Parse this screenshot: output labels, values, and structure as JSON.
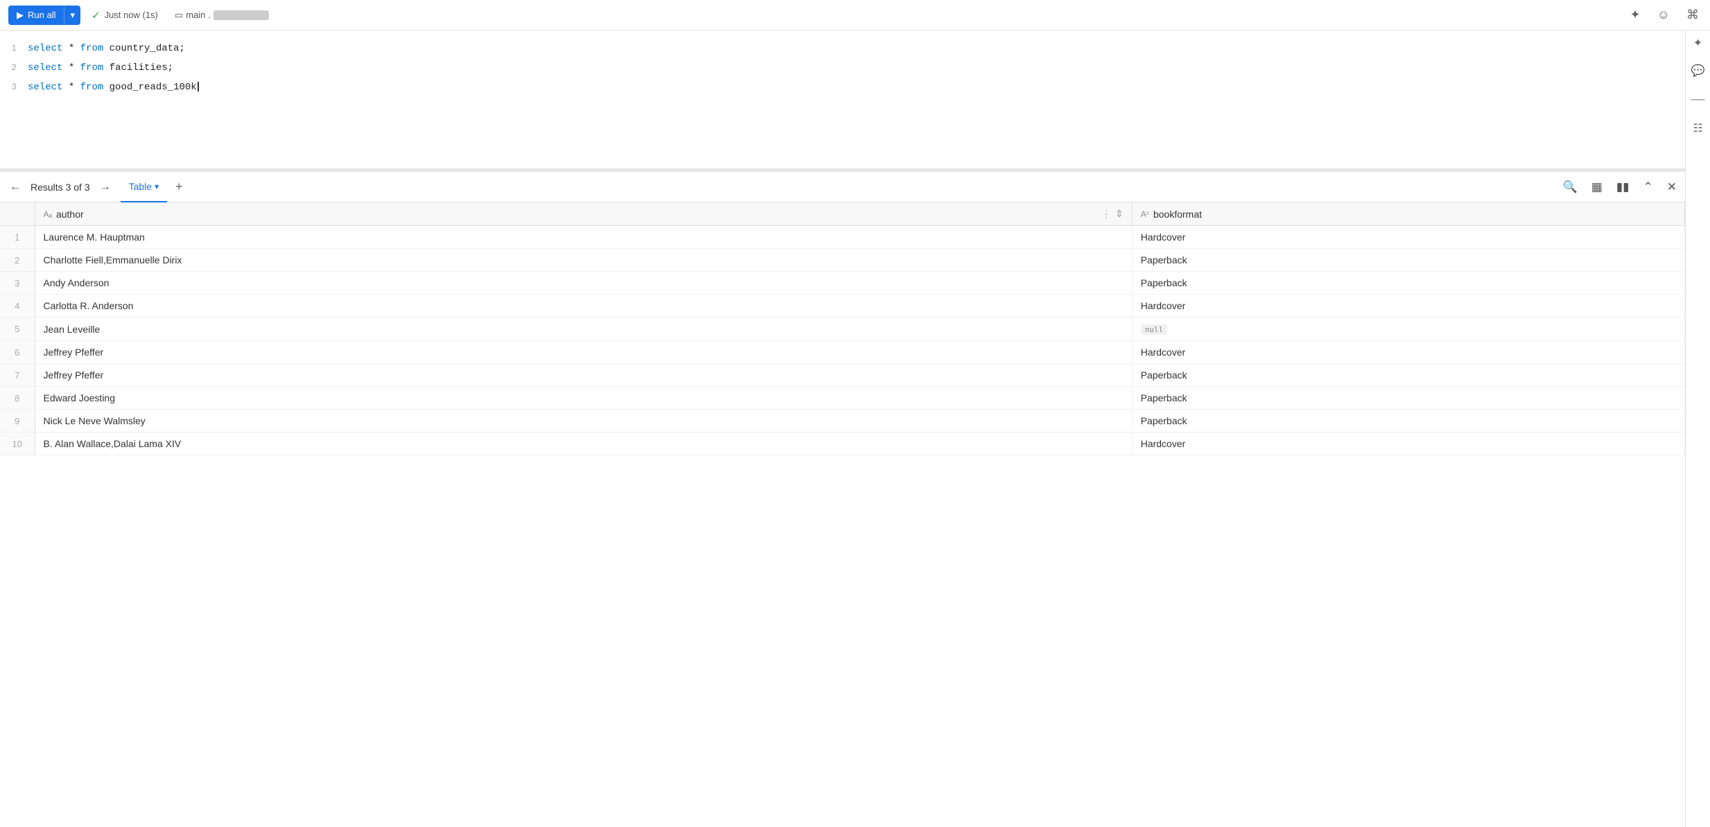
{
  "toolbar": {
    "run_all_label": "Run all",
    "status_text": "Just now (1s)",
    "db_name": "main .",
    "db_schema": "",
    "spark_icon": "✦",
    "chat_icon": "💬",
    "keyboard_icon": "⌘"
  },
  "editor": {
    "lines": [
      {
        "number": 1,
        "content": "select * from country_data;"
      },
      {
        "number": 2,
        "content": "select * from facilities;"
      },
      {
        "number": 3,
        "content": "select * from good_reads_100k"
      }
    ]
  },
  "results": {
    "label": "Results 3 of 3",
    "tab_label": "Table",
    "add_tab_label": "+",
    "columns": [
      {
        "name": "author",
        "type_icon": "Aa"
      },
      {
        "name": "bookformat",
        "type_icon": "Ac"
      }
    ],
    "rows": [
      {
        "num": 1,
        "author": "Laurence M. Hauptman",
        "bookformat": "Hardcover"
      },
      {
        "num": 2,
        "author": "Charlotte Fiell,Emmanuelle Dirix",
        "bookformat": "Paperback"
      },
      {
        "num": 3,
        "author": "Andy Anderson",
        "bookformat": "Paperback"
      },
      {
        "num": 4,
        "author": "Carlotta R. Anderson",
        "bookformat": "Hardcover"
      },
      {
        "num": 5,
        "author": "Jean Leveille",
        "bookformat": null
      },
      {
        "num": 6,
        "author": "Jeffrey Pfeffer",
        "bookformat": "Hardcover"
      },
      {
        "num": 7,
        "author": "Jeffrey Pfeffer",
        "bookformat": "Paperback"
      },
      {
        "num": 8,
        "author": "Edward Joesting",
        "bookformat": "Paperback"
      },
      {
        "num": 9,
        "author": "Nick Le Neve Walmsley",
        "bookformat": "Paperback"
      },
      {
        "num": 10,
        "author": "B. Alan Wallace,Dalai Lama XIV",
        "bookformat": "Hardcover"
      }
    ]
  }
}
